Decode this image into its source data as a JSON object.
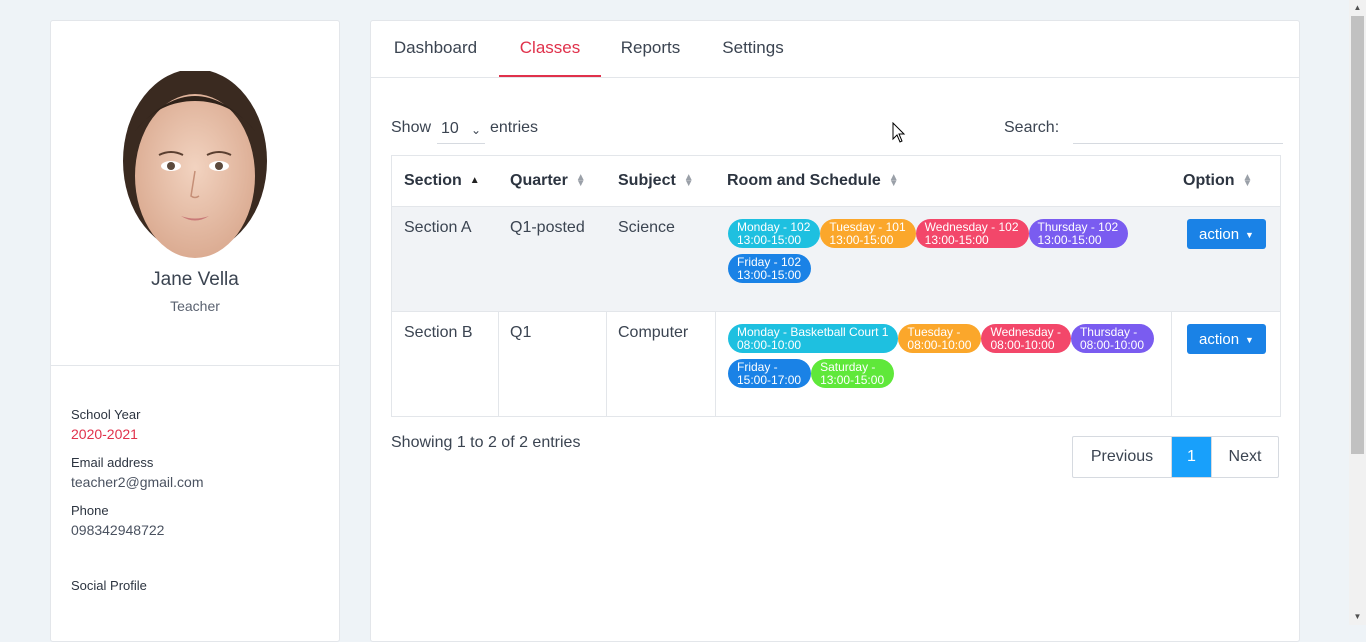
{
  "profile": {
    "name": "Jane Vella",
    "role": "Teacher",
    "school_year_label": "School Year",
    "school_year": "2020-2021",
    "email_label": "Email address",
    "email": "teacher2@gmail.com",
    "phone_label": "Phone",
    "phone": "098342948722",
    "social_label": "Social Profile"
  },
  "tabs": [
    "Dashboard",
    "Classes",
    "Reports",
    "Settings"
  ],
  "active_tab": "Classes",
  "table_controls": {
    "show_label": "Show",
    "page_length": "10",
    "entries_label": "entries",
    "search_label": "Search:",
    "search_value": ""
  },
  "table": {
    "headers": [
      "Section",
      "Quarter",
      "Subject",
      "Room and Schedule",
      "Option"
    ],
    "sorted_column": "Section",
    "rows": [
      {
        "section": "Section A",
        "quarter": "Q1-posted",
        "subject": "Science",
        "schedule": [
          {
            "day": "Monday - 102",
            "time": "13:00-15:00",
            "color": "#1ec0e0"
          },
          {
            "day": "Tuesday - 101",
            "time": "13:00-15:00",
            "color": "#fba72b"
          },
          {
            "day": "Wednesday - 102",
            "time": "13:00-15:00",
            "color": "#f3476a"
          },
          {
            "day": "Thursday - 102",
            "time": "13:00-15:00",
            "color": "#7a5cf0"
          },
          {
            "day": "Friday - 102",
            "time": "13:00-15:00",
            "color": "#1a82e6"
          }
        ],
        "action_label": "action"
      },
      {
        "section": "Section B",
        "quarter": "Q1",
        "subject": "Computer",
        "schedule": [
          {
            "day": "Monday - Basketball Court 1",
            "time": "08:00-10:00",
            "color": "#1ec0e0"
          },
          {
            "day": "Tuesday -",
            "time": "08:00-10:00",
            "color": "#fba72b"
          },
          {
            "day": "Wednesday -",
            "time": "08:00-10:00",
            "color": "#f3476a"
          },
          {
            "day": "Thursday -",
            "time": "08:00-10:00",
            "color": "#7a5cf0"
          },
          {
            "day": "Friday -",
            "time": "15:00-17:00",
            "color": "#1a82e6"
          },
          {
            "day": "Saturday -",
            "time": "13:00-15:00",
            "color": "#5fe83a"
          }
        ],
        "action_label": "action"
      }
    ]
  },
  "footer": {
    "info": "Showing 1 to 2 of 2 entries",
    "previous": "Previous",
    "current_page": "1",
    "next": "Next"
  },
  "colors": {
    "accent": "#e0314b",
    "primary": "#1a82e6",
    "page_active": "#18a0fb"
  }
}
